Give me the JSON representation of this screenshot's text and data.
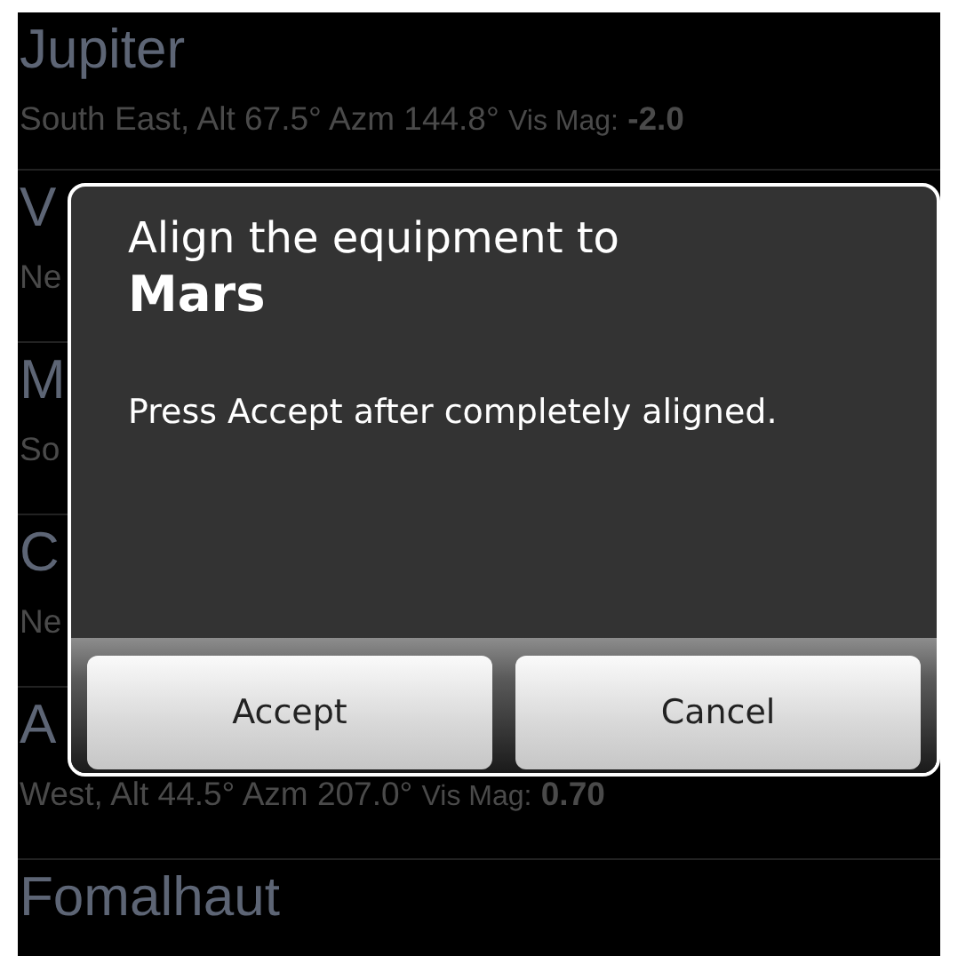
{
  "list": [
    {
      "name": "Jupiter",
      "location": "South East, Alt 67.5° Azm 144.8°",
      "mag_label": "Vis Mag:",
      "mag": "-2.0"
    },
    {
      "name": "V",
      "location": "Ne"
    },
    {
      "name": "M",
      "location": "So"
    },
    {
      "name": "C",
      "location": "Ne"
    },
    {
      "name": "A",
      "location": "West, Alt 44.5° Azm 207.0°",
      "mag_label": "Vis Mag:",
      "mag": "0.70"
    },
    {
      "name": "Fomalhaut"
    }
  ],
  "dialog": {
    "title": "Align the equipment to",
    "target": "Mars",
    "message": "Press Accept after completely aligned.",
    "buttons": [
      "Accept",
      "Cancel"
    ]
  }
}
